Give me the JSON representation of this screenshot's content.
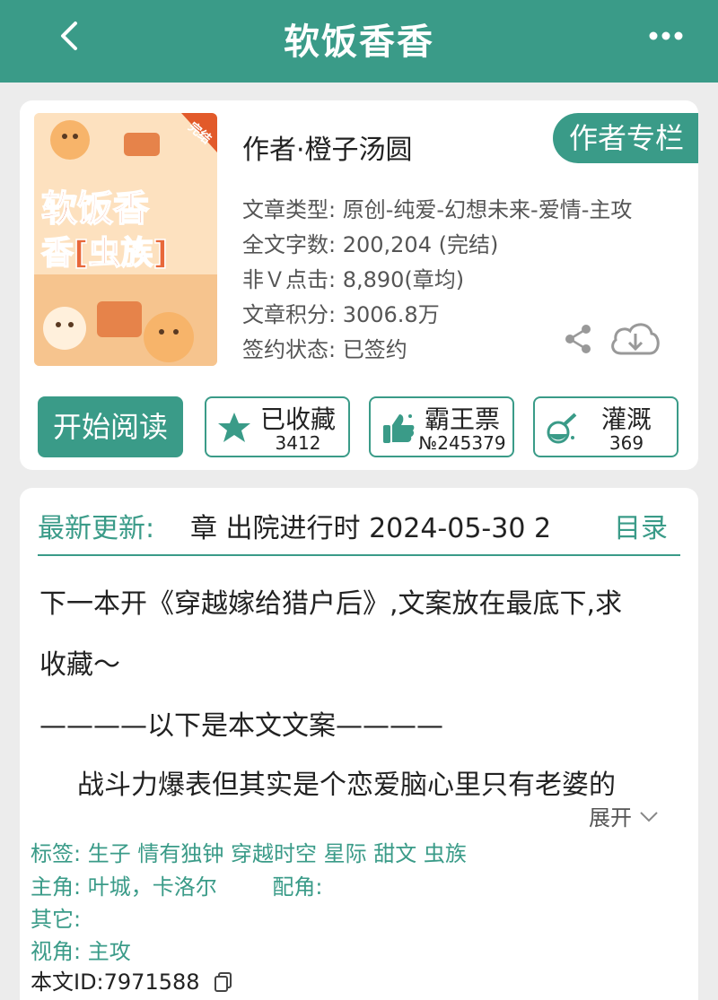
{
  "header": {
    "title": "软饭香香",
    "back_icon": "chevron-left-icon",
    "more_icon": "more-dots-icon"
  },
  "book": {
    "cover_badge": "完结",
    "cover_title": "软饭香香[虫族]",
    "author": "作者·橙子汤圆",
    "author_column": "作者专栏",
    "info": [
      "文章类型: 原创-纯爱-幻想未来-爱情-主攻",
      "全文字数: 200,204 (完结)",
      "非Ｖ点击: 8,890(章均)",
      "文章积分: 3006.8万",
      "签约状态: 已签约"
    ]
  },
  "actions": {
    "read": "开始阅读",
    "collect": {
      "label": "已收藏",
      "count": "3412",
      "icon": "star-icon"
    },
    "vote": {
      "label": "霸王票",
      "count": "№245379",
      "icon": "thumbs-up-icon"
    },
    "water": {
      "label": "灌溉",
      "count": "369",
      "icon": "watering-flask-icon"
    }
  },
  "latest": {
    "label": "最新更新:",
    "title": "章  出院进行时  2024-05-30 2",
    "toc": "目录"
  },
  "description": {
    "line1": "下一本开《穿越嫁给猎户后》,文案放在最底下,求",
    "line2": "收藏～",
    "line3": "————以下是本文文案————",
    "line4": "战斗力爆表但其实是个恋爱脑心里只有老婆的",
    "expand": "展开"
  },
  "meta": {
    "tags_label": "标签:",
    "tags": "生子 情有独钟 穿越时空 星际 甜文 虫族",
    "lead_label": "主角:",
    "lead": "叶城，卡洛尔",
    "support_label": "配角:",
    "support": "",
    "other_label": "其它:",
    "other": "",
    "pov_label": "视角:",
    "pov": "主攻",
    "id": "本文ID:7971588"
  },
  "colors": {
    "accent": "#3a9b88",
    "background": "#ececec"
  }
}
